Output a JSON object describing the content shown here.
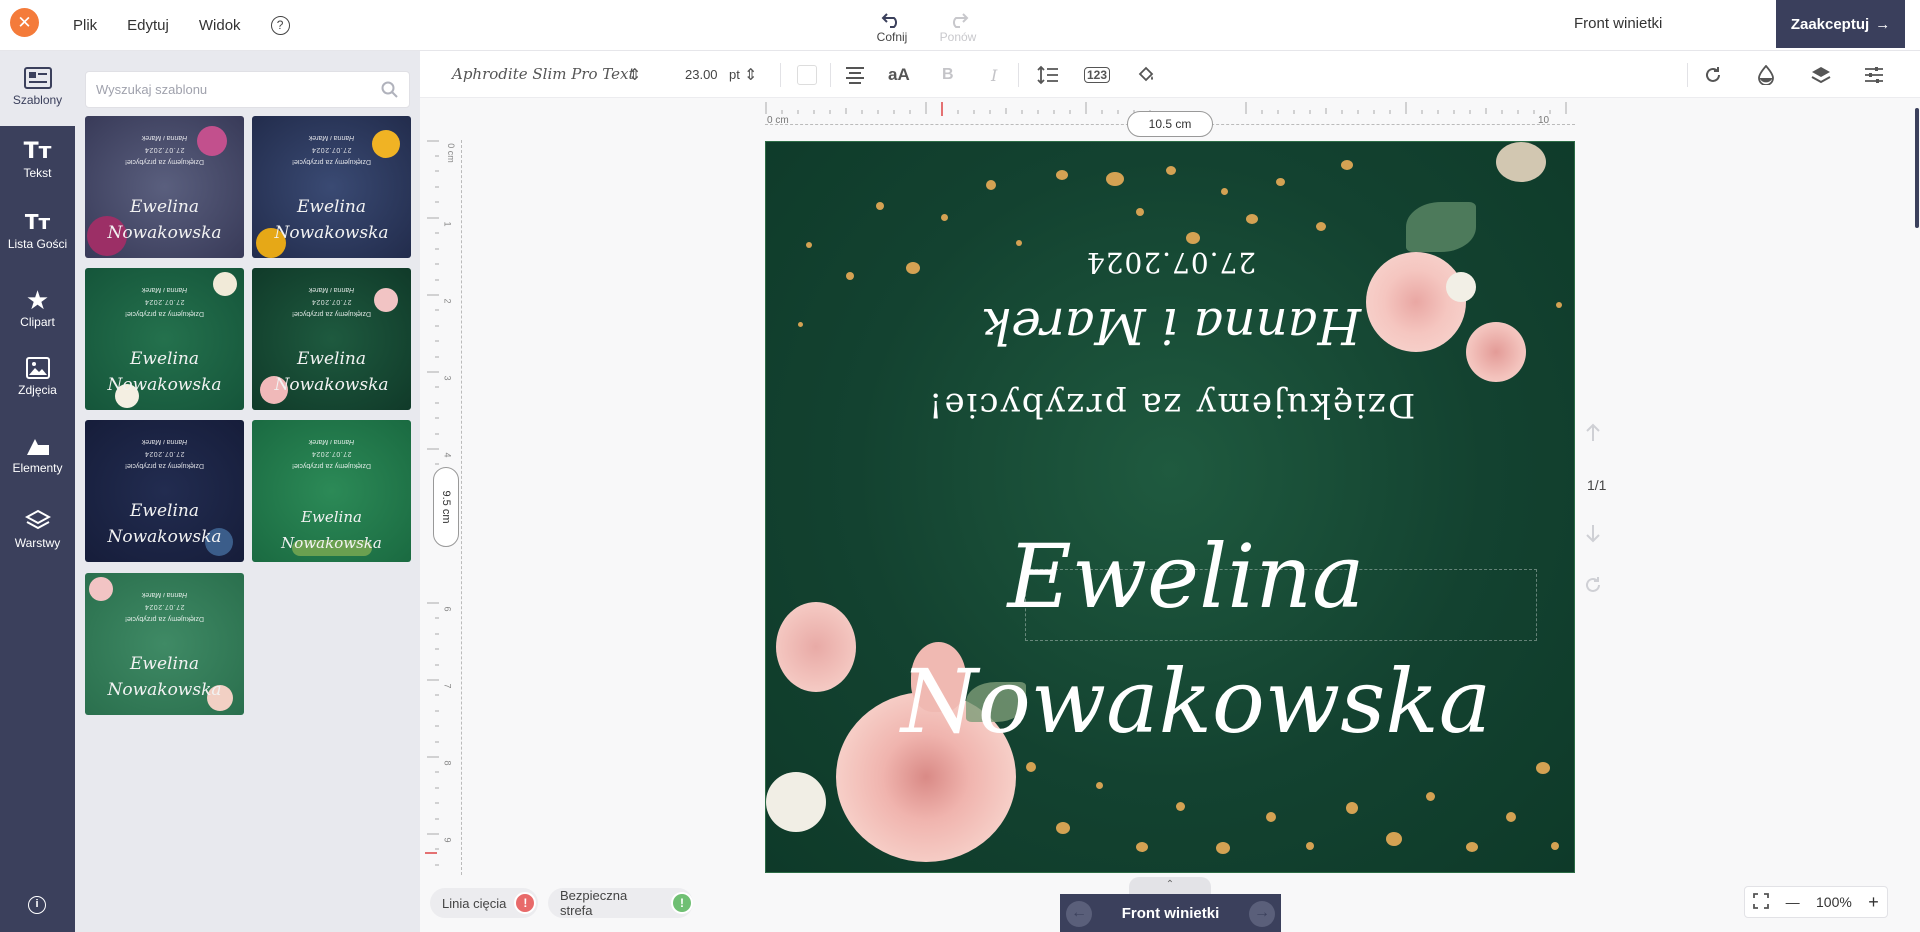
{
  "topbar": {
    "menu": [
      "Plik",
      "Edytuj",
      "Widok"
    ],
    "help": "?",
    "undo_label": "Cofnij",
    "redo_label": "Ponów",
    "doc_title": "Front winietki",
    "accept_label": "Zaakceptuj"
  },
  "sidebar": {
    "items": [
      {
        "label": "Szablony",
        "icon": "templates-icon"
      },
      {
        "label": "Tekst",
        "icon": "text-icon"
      },
      {
        "label": "Lista Gości",
        "icon": "guest-list-icon"
      },
      {
        "label": "Clipart",
        "icon": "star-icon"
      },
      {
        "label": "Zdjęcia",
        "icon": "image-icon"
      },
      {
        "label": "Elementy",
        "icon": "shapes-icon"
      },
      {
        "label": "Warstwy",
        "icon": "layers-icon"
      }
    ],
    "info": "i"
  },
  "panel": {
    "search_placeholder": "Wyszukaj szablonu",
    "thumb_line1": "Dziękujemy za przybycie!",
    "thumb_line2": "Hanna i Marek",
    "thumb_line3": "27.07.2024",
    "thumb_first": "Ewelina",
    "thumb_last": "Nowakowska",
    "thumb_full": "Ewelina Nowakowska"
  },
  "toolbar": {
    "font_name": "Aphrodite Slim Pro Text",
    "font_size": "23.00",
    "unit": "pt"
  },
  "rulers": {
    "width_label": "10.5 cm",
    "height_label": "9.5 cm",
    "top_start": "0 cm",
    "top_end": "10",
    "left_ticks": [
      "0 cm",
      "1",
      "2",
      "3",
      "4",
      "6",
      "7",
      "8",
      "9"
    ]
  },
  "card": {
    "date": "27.07.2024",
    "couple": "Hanna i Marek",
    "thanks": "Dziękujemy za przybycie!",
    "first_name": "Ewelina",
    "last_name": "Nowakowska"
  },
  "pages": {
    "indicator": "1/1"
  },
  "bottom": {
    "cut_line": "Linia cięcia",
    "safe_zone": "Bezpieczna strefa",
    "side_label": "Front winietki",
    "zoom": "100%",
    "cut_color": "#e86a6a",
    "safe_color": "#6fbf73"
  }
}
